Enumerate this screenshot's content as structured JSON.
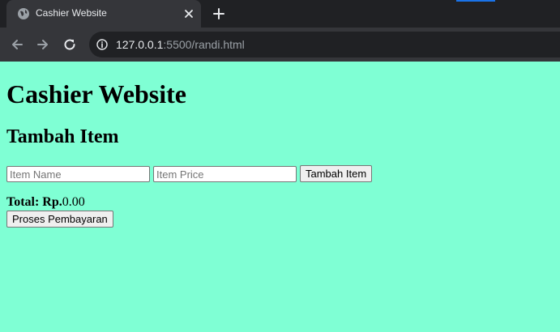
{
  "browser": {
    "tab_title": "Cashier Website",
    "url_host": "127.0.0.1",
    "url_rest": ":5500/randi.html"
  },
  "page": {
    "title": "Cashier Website",
    "subtitle": "Tambah Item",
    "item_name_placeholder": "Item Name",
    "item_price_placeholder": "Item Price",
    "add_button_label": "Tambah Item",
    "total_label": "Total: Rp.",
    "total_value": "0.00",
    "pay_button_label": "Proses Pembayaran"
  },
  "colors": {
    "page_background": "#7fffd4",
    "chrome_dark": "#202124",
    "chrome_tab": "#35363a"
  }
}
